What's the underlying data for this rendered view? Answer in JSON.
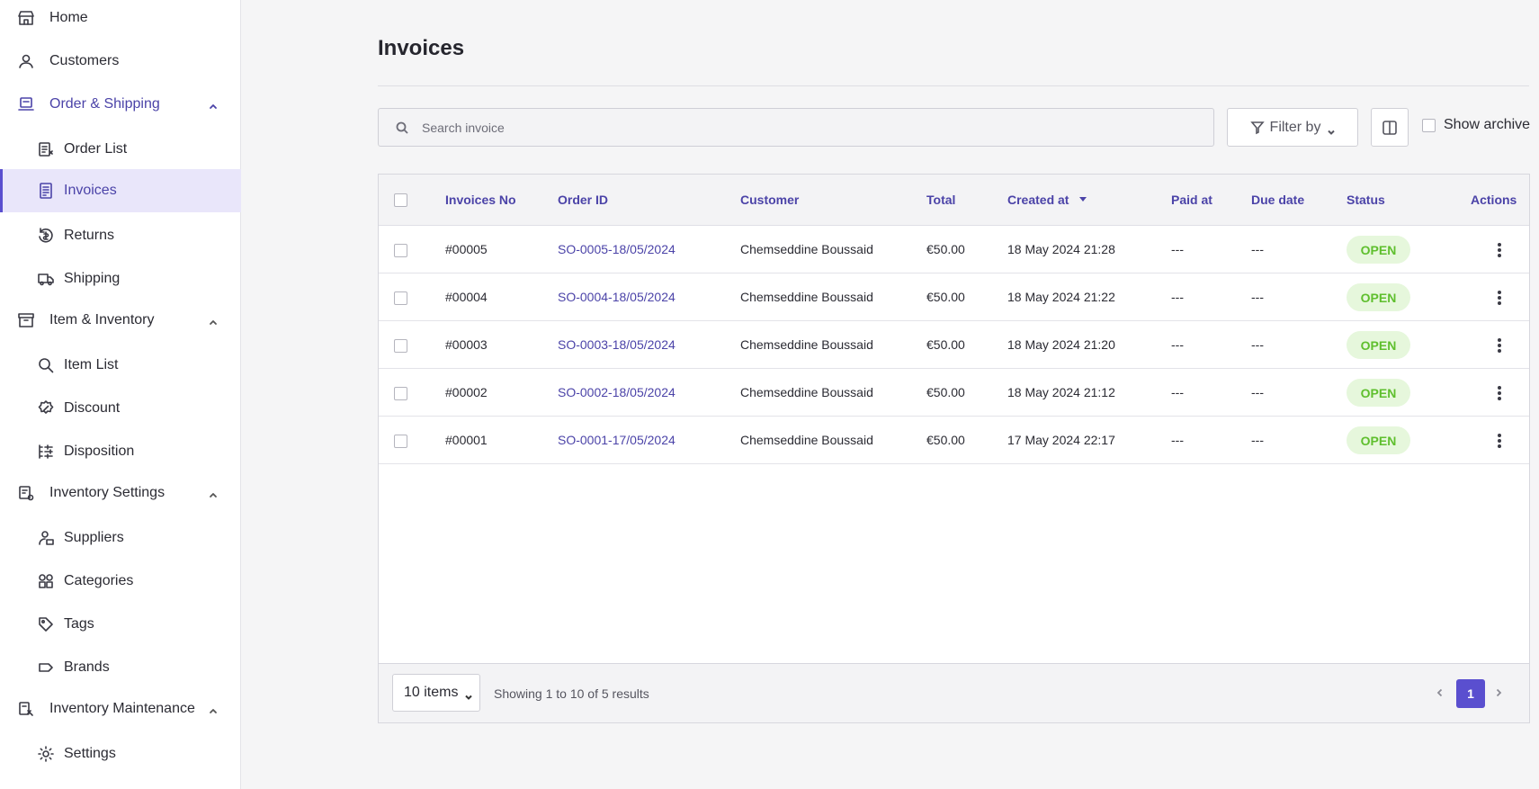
{
  "sidebar": {
    "items": [
      {
        "label": "Home",
        "icon": "store-icon"
      },
      {
        "label": "Customers",
        "icon": "user-icon"
      },
      {
        "label": "Order & Shipping",
        "icon": "cart-icon"
      },
      {
        "label": "Order List",
        "icon": "order-list-icon"
      },
      {
        "label": "Invoices",
        "icon": "invoice-icon"
      },
      {
        "label": "Returns",
        "icon": "returns-icon"
      },
      {
        "label": "Shipping",
        "icon": "truck-icon"
      },
      {
        "label": "Item & Inventory",
        "icon": "archive-icon"
      },
      {
        "label": "Item List",
        "icon": "search-icon"
      },
      {
        "label": "Discount",
        "icon": "discount-icon"
      },
      {
        "label": "Disposition",
        "icon": "disposition-icon"
      },
      {
        "label": "Inventory Settings",
        "icon": "inventory-settings-icon"
      },
      {
        "label": "Suppliers",
        "icon": "suppliers-icon"
      },
      {
        "label": "Categories",
        "icon": "categories-icon"
      },
      {
        "label": "Tags",
        "icon": "tag-icon"
      },
      {
        "label": "Brands",
        "icon": "brand-icon"
      },
      {
        "label": "Inventory Maintenance",
        "icon": "maintenance-icon"
      },
      {
        "label": "Settings",
        "icon": "gear-icon"
      }
    ]
  },
  "page": {
    "title": "Invoices"
  },
  "toolbar": {
    "search_placeholder": "Search invoice",
    "filter_label": "Filter by",
    "archive_label": "Show archive"
  },
  "table": {
    "headers": {
      "invoice_no": "Invoices No",
      "order_id": "Order ID",
      "customer": "Customer",
      "total": "Total",
      "created_at": "Created at",
      "paid_at": "Paid at",
      "due_date": "Due date",
      "status": "Status",
      "actions": "Actions"
    },
    "rows": [
      {
        "invoice_no": "#00005",
        "order_id": "SO-0005-18/05/2024",
        "customer": "Chemseddine Boussaid",
        "total": "€50.00",
        "created_at": "18 May 2024 21:28",
        "paid_at": "---",
        "due_date": "---",
        "status": "OPEN"
      },
      {
        "invoice_no": "#00004",
        "order_id": "SO-0004-18/05/2024",
        "customer": "Chemseddine Boussaid",
        "total": "€50.00",
        "created_at": "18 May 2024 21:22",
        "paid_at": "---",
        "due_date": "---",
        "status": "OPEN"
      },
      {
        "invoice_no": "#00003",
        "order_id": "SO-0003-18/05/2024",
        "customer": "Chemseddine Boussaid",
        "total": "€50.00",
        "created_at": "18 May 2024 21:20",
        "paid_at": "---",
        "due_date": "---",
        "status": "OPEN"
      },
      {
        "invoice_no": "#00002",
        "order_id": "SO-0002-18/05/2024",
        "customer": "Chemseddine Boussaid",
        "total": "€50.00",
        "created_at": "18 May 2024 21:12",
        "paid_at": "---",
        "due_date": "---",
        "status": "OPEN"
      },
      {
        "invoice_no": "#00001",
        "order_id": "SO-0001-17/05/2024",
        "customer": "Chemseddine Boussaid",
        "total": "€50.00",
        "created_at": "17 May 2024 22:17",
        "paid_at": "---",
        "due_date": "---",
        "status": "OPEN"
      }
    ]
  },
  "footer": {
    "items_per_page": "10 items",
    "showing": "Showing 1 to 10 of 5 results",
    "current_page": "1"
  },
  "colors": {
    "accent": "#4b43a8",
    "active_bg": "#e9e6fa",
    "status_open_bg": "#e6f7dc",
    "status_open_text": "#5fbf2e"
  }
}
